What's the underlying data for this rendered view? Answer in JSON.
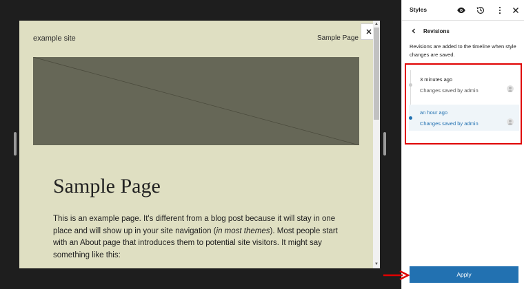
{
  "canvas": {
    "site_title": "example site",
    "nav_link": "Sample Page",
    "page_heading": "Sample Page",
    "body_text_before": "This is an example page. It's different from a blog post because it will stay in one place and will show up in your site navigation (",
    "body_text_italic": "in most themes",
    "body_text_after": "). Most people start with an About page that introduces them to potential site visitors. It might say something like this:",
    "background_color": "#dfdfc2",
    "image_color": "#666757"
  },
  "sidebar": {
    "title": "Styles",
    "icons": [
      "eye-icon",
      "history-icon",
      "more-vertical-icon",
      "close-icon"
    ],
    "back_label": "Revisions",
    "description": "Revisions are added to the timeline when style changes are saved.",
    "revisions": [
      {
        "time": "3 minutes ago",
        "author": "Changes saved by admin",
        "selected": false
      },
      {
        "time": "an hour ago",
        "author": "Changes saved by admin",
        "selected": true
      }
    ],
    "apply_label": "Apply"
  },
  "colors": {
    "accent": "#2271b1",
    "highlight_border": "#e00000",
    "annotation_arrow": "#e00000"
  }
}
